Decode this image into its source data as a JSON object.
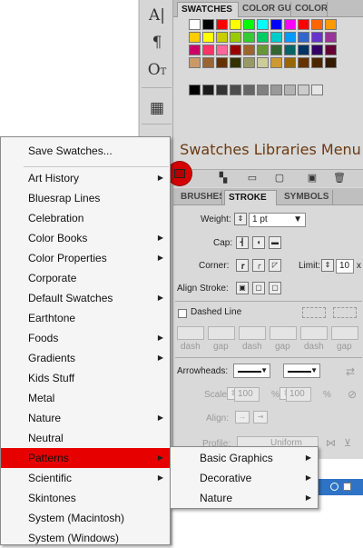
{
  "swatches_panel": {
    "tabs": [
      "SWATCHES",
      "COLOR GUI",
      "COLOR"
    ],
    "annotation": "Swatches Libraries Menu",
    "colors": {
      "row1": [
        "#ffffff",
        "#000000",
        "#ff0000",
        "#ffff00",
        "#00ff00",
        "#00ffff",
        "#0000ff",
        "#ff00ff",
        "#ff0000",
        "#ff6600",
        "#ff9900"
      ],
      "row2": [
        "#ffcc00",
        "#ffff00",
        "#cccc00",
        "#99cc00",
        "#33cc33",
        "#00cc66",
        "#00cccc",
        "#0099ff",
        "#3366cc",
        "#6633cc",
        "#993399"
      ],
      "row3": [
        "#cc0066",
        "#ff3366",
        "#ff6699",
        "#990000",
        "#996633",
        "#669933",
        "#336633",
        "#006666",
        "#003366",
        "#330066",
        "#660033"
      ],
      "row4": [
        "#cc9966",
        "#996633",
        "#663300",
        "#333300",
        "#999966",
        "#cccc99",
        "#cc9933",
        "#996600",
        "#663300",
        "#4d2600",
        "#331a00"
      ],
      "grays": [
        "#000000",
        "#1a1a1a",
        "#333333",
        "#4d4d4d",
        "#666666",
        "#808080",
        "#999999",
        "#b3b3b3",
        "#cccccc",
        "#e6e6e6"
      ]
    }
  },
  "stroke_panel": {
    "tabs": [
      "BRUSHES",
      "STROKE",
      "SYMBOLS"
    ],
    "weight_label": "Weight:",
    "weight_value": "1 pt",
    "cap_label": "Cap:",
    "corner_label": "Corner:",
    "limit_label": "Limit:",
    "limit_value": "10",
    "limit_unit": "x",
    "align_label": "Align Stroke:",
    "dashed_label": "Dashed Line",
    "dash_labels": [
      "dash",
      "gap",
      "dash",
      "gap",
      "dash",
      "gap"
    ],
    "arrowheads_label": "Arrowheads:",
    "scale_label": "Scale:",
    "scale_value_1": "100",
    "scale_value_2": "100",
    "percent": "%",
    "align_arrow_label": "Align:",
    "profile_label": "Profile:",
    "profile_value": "Uniform"
  },
  "main_menu": {
    "items": [
      {
        "label": "Save Swatches...",
        "submenu": false
      },
      {
        "label": "Art History",
        "submenu": true
      },
      {
        "label": "Bluesrap Lines",
        "submenu": false
      },
      {
        "label": "Celebration",
        "submenu": false
      },
      {
        "label": "Color Books",
        "submenu": true
      },
      {
        "label": "Color Properties",
        "submenu": true
      },
      {
        "label": "Corporate",
        "submenu": false
      },
      {
        "label": "Default Swatches",
        "submenu": true
      },
      {
        "label": "Earthtone",
        "submenu": false
      },
      {
        "label": "Foods",
        "submenu": true
      },
      {
        "label": "Gradients",
        "submenu": true
      },
      {
        "label": "Kids Stuff",
        "submenu": false
      },
      {
        "label": "Metal",
        "submenu": false
      },
      {
        "label": "Nature",
        "submenu": true
      },
      {
        "label": "Neutral",
        "submenu": false
      },
      {
        "label": "Patterns",
        "submenu": true
      },
      {
        "label": "Scientific",
        "submenu": true
      },
      {
        "label": "Skintones",
        "submenu": false
      },
      {
        "label": "System (Macintosh)",
        "submenu": false
      },
      {
        "label": "System (Windows)",
        "submenu": false
      }
    ],
    "highlighted": "Patterns",
    "highlight_color": "#e60000"
  },
  "sub_menu": {
    "items": [
      {
        "label": "Basic Graphics",
        "submenu": true
      },
      {
        "label": "Decorative",
        "submenu": true
      },
      {
        "label": "Nature",
        "submenu": true
      }
    ]
  },
  "icons": {
    "arrow": "▶"
  }
}
